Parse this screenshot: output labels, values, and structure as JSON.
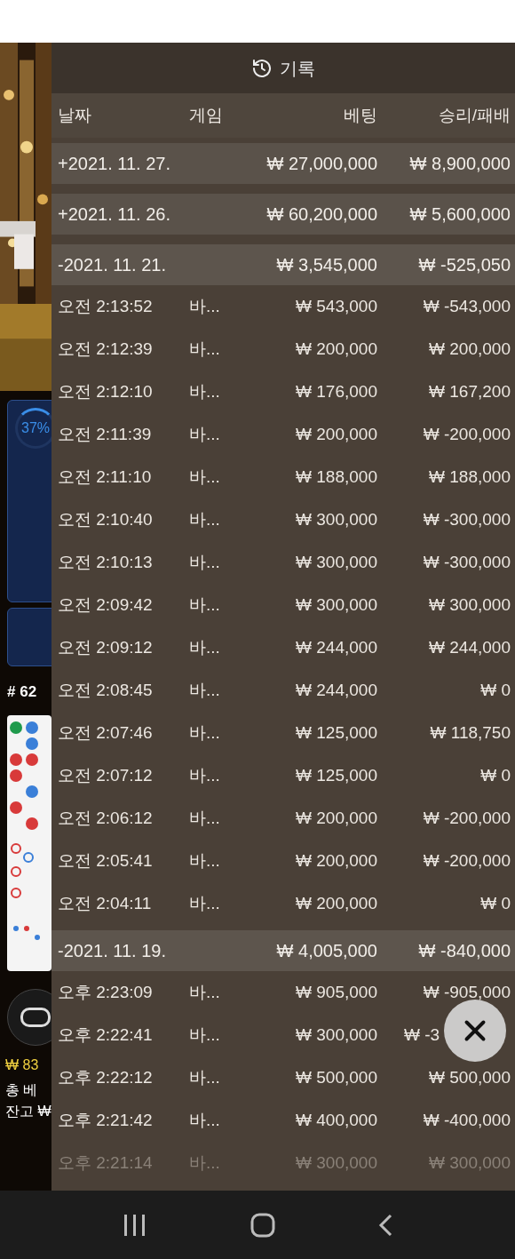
{
  "side": {
    "progress": "37%",
    "round": "# 62",
    "amount": "₩ 83",
    "total_bet": "총 베",
    "balance": "잔고 ₩"
  },
  "history": {
    "title": "기록",
    "columns": [
      "날짜",
      "게임",
      "베팅",
      "승리/패배"
    ],
    "groups": [
      {
        "date": "+2021. 11. 27.",
        "bet": "₩ 27,000,000",
        "result": "₩ 8,900,000"
      },
      {
        "date": "+2021. 11. 26.",
        "bet": "₩ 60,200,000",
        "result": "₩ 5,600,000"
      },
      {
        "date": "-2021. 11. 21.",
        "bet": "₩ 3,545,000",
        "result": "₩ -525,050",
        "rows": [
          {
            "time": "오전 2:13:52",
            "game": "바...",
            "bet": "₩ 543,000",
            "result": "₩ -543,000",
            "faded": false
          },
          {
            "time": "오전 2:12:39",
            "game": "바...",
            "bet": "₩ 200,000",
            "result": "₩ 200,000",
            "faded": false
          },
          {
            "time": "오전 2:12:10",
            "game": "바...",
            "bet": "₩ 176,000",
            "result": "₩ 167,200",
            "faded": false
          },
          {
            "time": "오전 2:11:39",
            "game": "바...",
            "bet": "₩ 200,000",
            "result": "₩ -200,000",
            "faded": false
          },
          {
            "time": "오전 2:11:10",
            "game": "바...",
            "bet": "₩ 188,000",
            "result": "₩ 188,000",
            "faded": false
          },
          {
            "time": "오전 2:10:40",
            "game": "바...",
            "bet": "₩ 300,000",
            "result": "₩ -300,000",
            "faded": false
          },
          {
            "time": "오전 2:10:13",
            "game": "바...",
            "bet": "₩ 300,000",
            "result": "₩ -300,000",
            "faded": false
          },
          {
            "time": "오전 2:09:42",
            "game": "바...",
            "bet": "₩ 300,000",
            "result": "₩ 300,000",
            "faded": false
          },
          {
            "time": "오전 2:09:12",
            "game": "바...",
            "bet": "₩ 244,000",
            "result": "₩ 244,000",
            "faded": false
          },
          {
            "time": "오전 2:08:45",
            "game": "바...",
            "bet": "₩ 244,000",
            "result": "₩ 0",
            "faded": false
          },
          {
            "time": "오전 2:07:46",
            "game": "바...",
            "bet": "₩ 125,000",
            "result": "₩ 118,750",
            "faded": false
          },
          {
            "time": "오전 2:07:12",
            "game": "바...",
            "bet": "₩ 125,000",
            "result": "₩ 0",
            "faded": false
          },
          {
            "time": "오전 2:06:12",
            "game": "바...",
            "bet": "₩ 200,000",
            "result": "₩ -200,000",
            "faded": false
          },
          {
            "time": "오전 2:05:41",
            "game": "바...",
            "bet": "₩ 200,000",
            "result": "₩ -200,000",
            "faded": false
          },
          {
            "time": "오전 2:04:11",
            "game": "바...",
            "bet": "₩ 200,000",
            "result": "₩ 0",
            "faded": false
          }
        ]
      },
      {
        "date": "-2021. 11. 19.",
        "bet": "₩ 4,005,000",
        "result": "₩ -840,000",
        "rows": [
          {
            "time": "오후 2:23:09",
            "game": "바...",
            "bet": "₩ 905,000",
            "result": "₩ -905,000",
            "faded": false
          },
          {
            "time": "오후 2:22:41",
            "game": "바...",
            "bet": "₩ 300,000",
            "result": "₩ -3",
            "faded": false,
            "covered": true
          },
          {
            "time": "오후 2:22:12",
            "game": "바...",
            "bet": "₩ 500,000",
            "result": "₩ 500,000",
            "faded": false
          },
          {
            "time": "오후 2:21:42",
            "game": "바...",
            "bet": "₩ 400,000",
            "result": "₩ -400,000",
            "faded": false
          },
          {
            "time": "오후 2:21:14",
            "game": "바...",
            "bet": "₩ 300,000",
            "result": "₩ 300,000",
            "faded": true
          }
        ]
      }
    ]
  }
}
